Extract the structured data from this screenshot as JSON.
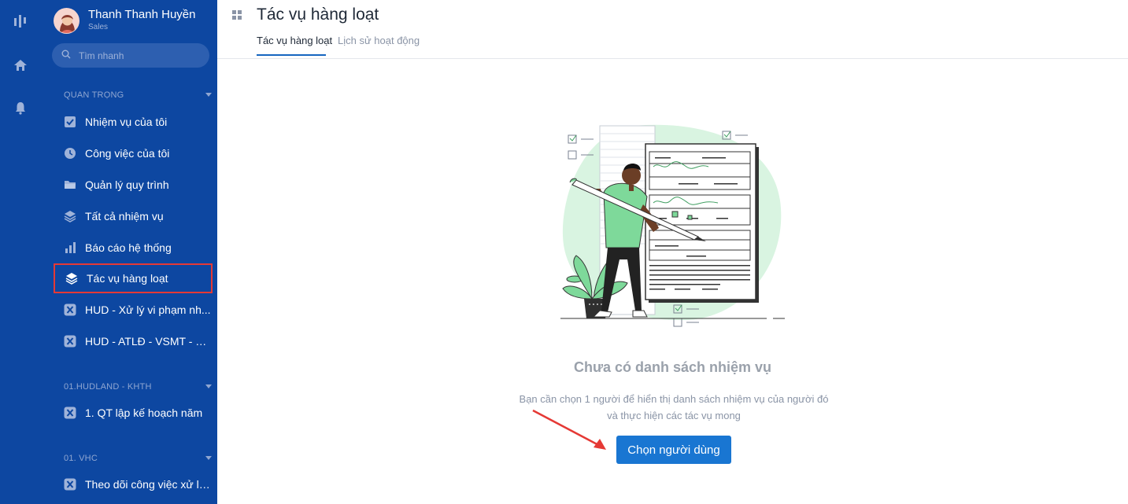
{
  "user": {
    "name": "Thanh Thanh Huyền",
    "role": "Sales"
  },
  "search": {
    "placeholder": "Tìm nhanh"
  },
  "sections": [
    {
      "label": "QUAN TRỌNG"
    },
    {
      "label": "01.HUDLAND - KHTH"
    },
    {
      "label": "01. VHC"
    }
  ],
  "nav": [
    {
      "label": "Nhiệm vụ của tôi",
      "icon": "check-square-icon"
    },
    {
      "label": "Công việc của tôi",
      "icon": "clock-icon"
    },
    {
      "label": "Quản lý quy trình",
      "icon": "folder-icon"
    },
    {
      "label": "Tất cả nhiệm vụ",
      "icon": "layers-icon"
    },
    {
      "label": "Báo cáo hệ thống",
      "icon": "bar-chart-icon"
    },
    {
      "label": "Tác vụ hàng loạt",
      "icon": "stack-icon"
    },
    {
      "label": "HUD - Xử lý vi phạm nh...",
      "icon": "x-app-icon"
    },
    {
      "label": "HUD - ATLĐ - VSMT - PCCN",
      "icon": "x-app-icon"
    },
    {
      "label": "1. QT lập kế hoạch năm",
      "icon": "x-app-icon"
    },
    {
      "label": "Theo dõi công việc xử lý...",
      "icon": "x-app-icon"
    }
  ],
  "header": {
    "title": "Tác vụ hàng loạt",
    "tabs": [
      {
        "label": "Tác vụ hàng loạt"
      },
      {
        "label": "Lịch sử hoạt động"
      }
    ]
  },
  "empty": {
    "title": "Chưa có danh sách nhiệm vụ",
    "desc_line1": "Bạn cần chọn 1 người để hiển thị danh sách nhiệm vụ của người đó",
    "desc_line2": "và thực hiện các tác vụ mong",
    "button": "Chọn người dùng"
  },
  "colors": {
    "sidebar": "#0d47a1",
    "accent": "#1976d2",
    "highlight": "#e53935",
    "illustration": "#7ed99a"
  }
}
